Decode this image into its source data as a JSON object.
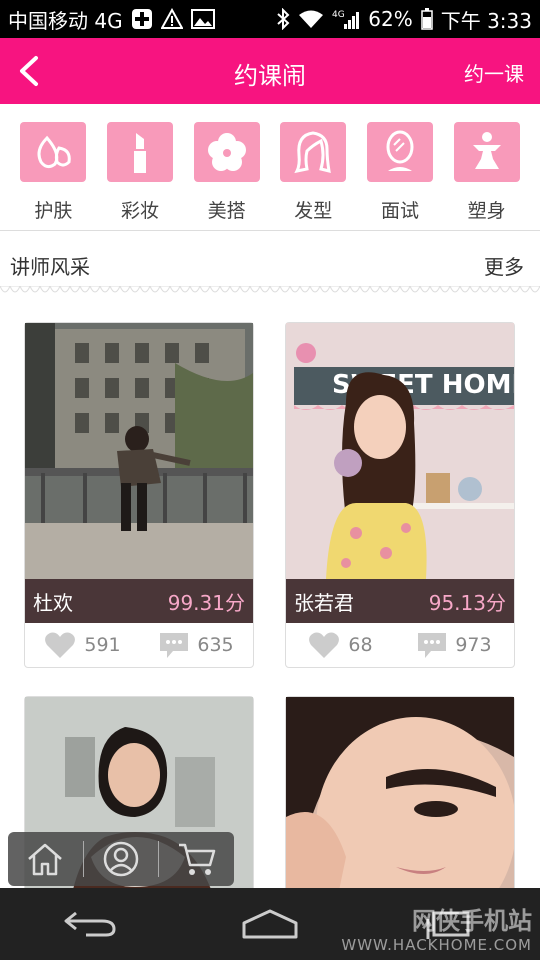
{
  "status_bar": {
    "carrier": "中国移动 4G",
    "signal_label": "4G",
    "battery": "62%",
    "time": "下午 3:33"
  },
  "header": {
    "title": "约课闹",
    "action_label": "约一课",
    "background": "#f71480"
  },
  "categories": [
    {
      "label": "护肤",
      "icon": "skincare-icon"
    },
    {
      "label": "彩妆",
      "icon": "lipstick-icon"
    },
    {
      "label": "美搭",
      "icon": "flower-icon"
    },
    {
      "label": "发型",
      "icon": "hair-icon"
    },
    {
      "label": "面试",
      "icon": "mirror-icon"
    },
    {
      "label": "塑身",
      "icon": "body-icon"
    }
  ],
  "section": {
    "title": "讲师风采",
    "more_label": "更多"
  },
  "teachers": [
    {
      "name": "杜欢",
      "score": "99.31分",
      "likes": "591",
      "comments": "635"
    },
    {
      "name": "张若君",
      "score": "95.13分",
      "likes": "68",
      "comments": "973",
      "photo_text": "SWEET HOME"
    },
    {
      "name": "",
      "score": "",
      "likes": "",
      "comments": ""
    },
    {
      "name": "",
      "score": "",
      "likes": "",
      "comments": ""
    }
  ],
  "toolbar": {
    "home_icon": "home-icon",
    "user_icon": "user-icon",
    "cart_icon": "cart-icon"
  },
  "watermark": {
    "line1": "网侠手机站",
    "line2": "WWW.HACKHOME.COM"
  },
  "colors": {
    "accent": "#f71480",
    "category_tile": "#f89aba",
    "card_bar": "#4a3638",
    "score": "#f7a8c8"
  }
}
